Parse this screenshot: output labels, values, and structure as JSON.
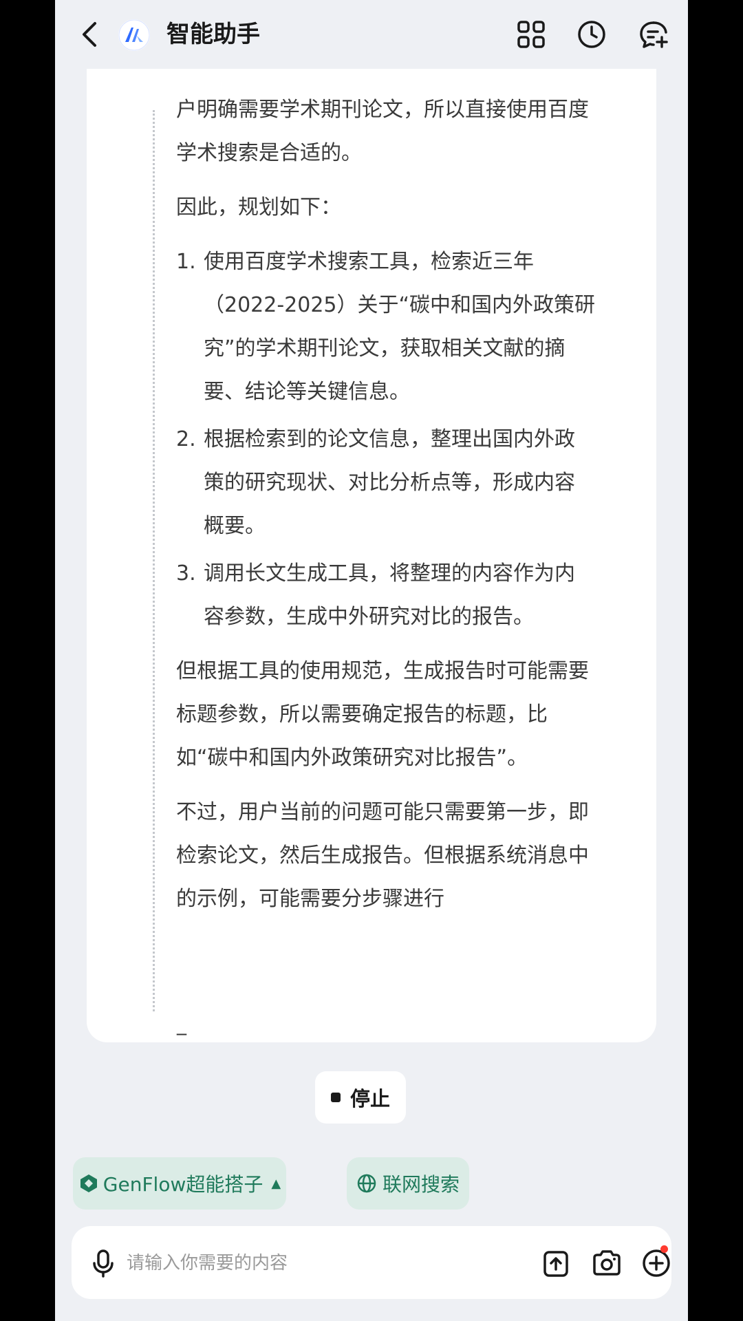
{
  "header": {
    "title": "智能助手"
  },
  "message": {
    "intro_lines": [
      "户明确需要学术期刊论文，所以直接使用百度",
      "学术搜索是合适的。"
    ],
    "plan_heading": "因此，规划如下：",
    "steps": [
      {
        "num": "1.",
        "lines": [
          "使用百度学术搜索工具，检索近三年",
          "（2022-2025）关于“碳中和国内外政策研",
          "究”的学术期刊论文，获取相关文献的摘",
          "要、结论等关键信息。"
        ]
      },
      {
        "num": "2.",
        "lines": [
          "根据检索到的论文信息，整理出国内外政",
          "策的研究现状、对比分析点等，形成内容",
          "概要。"
        ]
      },
      {
        "num": "3.",
        "lines": [
          "调用长文生成工具，将整理的内容作为内",
          "容参数，生成中外研究对比的报告。"
        ]
      }
    ],
    "para2_lines": [
      "但根据工具的使用规范，生成报告时可能需要",
      "标题参数，所以需要确定报告的标题，比",
      "如“碳中和国内外政策研究对比报告”。"
    ],
    "para3_lines": [
      "不过，用户当前的问题可能只需要第一步，即",
      "检索论文，然后生成报告。但根据系统消息中",
      "的示例，可能需要分步骤进行"
    ],
    "cursor": "_"
  },
  "stop_button": {
    "label": "停止"
  },
  "chips": {
    "genflow": "GenFlow超能搭子",
    "web_search": "联网搜索"
  },
  "input": {
    "placeholder": "请输入你需要的内容"
  },
  "colors": {
    "background": "#eef0f4",
    "card": "#ffffff",
    "chip_bg": "#dbece6",
    "chip_text": "#1f7a5b",
    "logo_blue": "#2f6bff",
    "notification_dot": "#ff3b30"
  },
  "icons": [
    "back-icon",
    "assistant-logo-icon",
    "apps-grid-icon",
    "history-clock-icon",
    "new-chat-icon",
    "stop-icon",
    "genflow-icon",
    "globe-icon",
    "microphone-icon",
    "upload-icon",
    "camera-icon",
    "plus-icon"
  ]
}
